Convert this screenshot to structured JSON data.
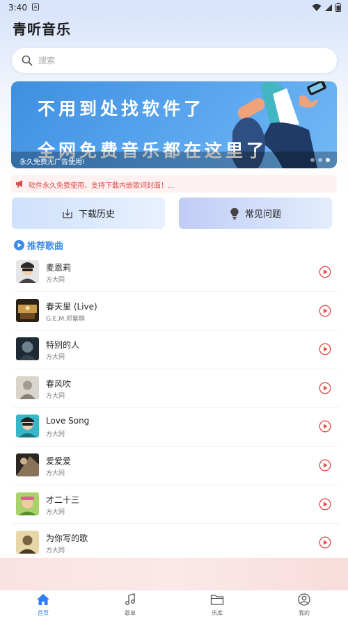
{
  "status_bar": {
    "time": "3:40",
    "notification_glyph": "A"
  },
  "app": {
    "title": "青听音乐"
  },
  "search": {
    "placeholder": "搜索",
    "value": "",
    "icon": "search-icon"
  },
  "banner": {
    "headline_1": "不用到处找软件了",
    "headline_2": "全网免费音乐都在这里了",
    "caption": "永久免费无广告使用!",
    "slide_count": 3,
    "active_slide": 3
  },
  "notice": {
    "icon": "megaphone-icon",
    "text": "软件永久免费使用，支持下载内嵌歌词封面！..."
  },
  "quick_actions": [
    {
      "label": "下载历史",
      "icon": "download-icon"
    },
    {
      "label": "常见问题",
      "icon": "lightbulb-icon"
    }
  ],
  "recommend": {
    "title": "推荐歌曲",
    "songs": [
      {
        "title": "麦恩莉",
        "artist": "方大同"
      },
      {
        "title": "春天里 (Live)",
        "artist": "G.E.M.邓紫棋"
      },
      {
        "title": "特别的人",
        "artist": "方大同"
      },
      {
        "title": "春风吹",
        "artist": "方大同"
      },
      {
        "title": "Love Song",
        "artist": "方大同"
      },
      {
        "title": "爱爱爱",
        "artist": "方大同"
      },
      {
        "title": "才二十三",
        "artist": "方大同"
      },
      {
        "title": "为你写的歌",
        "artist": "方大同"
      }
    ]
  },
  "tabs": [
    {
      "label": "首页",
      "icon": "home-icon",
      "active": true
    },
    {
      "label": "歌单",
      "icon": "music-note-icon",
      "active": false
    },
    {
      "label": "乐库",
      "icon": "folder-icon",
      "active": false
    },
    {
      "label": "我的",
      "icon": "profile-icon",
      "active": false
    }
  ],
  "colors": {
    "accent": "#3d8bea",
    "play_red": "#e84a4a",
    "notice_red": "#e04a4a",
    "tab_active": "#2f7ff0"
  }
}
